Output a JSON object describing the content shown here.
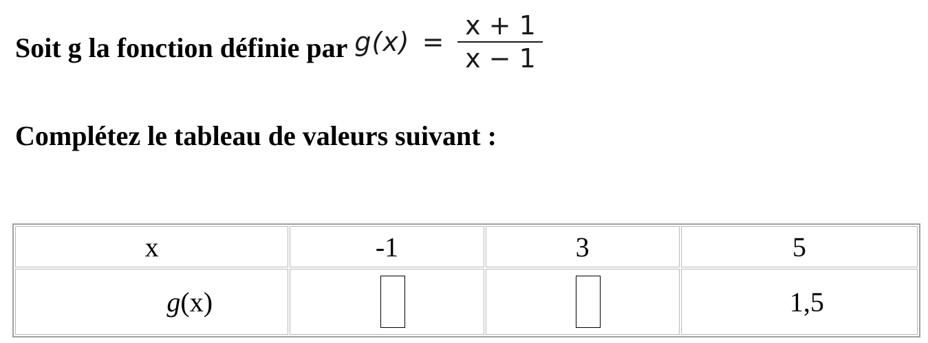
{
  "intro": {
    "text": "Soit g la fonction définie par",
    "formula": {
      "lhs": "g(x)",
      "equals": "=",
      "numerator": "x + 1",
      "denominator": "x − 1"
    }
  },
  "instruction": "Complétez le tableau de valeurs suivant :",
  "table": {
    "row_x": {
      "label": "x",
      "values": [
        "-1",
        "3",
        "5"
      ]
    },
    "row_gx": {
      "label_fn": "g",
      "label_arg": "(x)",
      "values": [
        "",
        "",
        "1,5"
      ]
    }
  }
}
